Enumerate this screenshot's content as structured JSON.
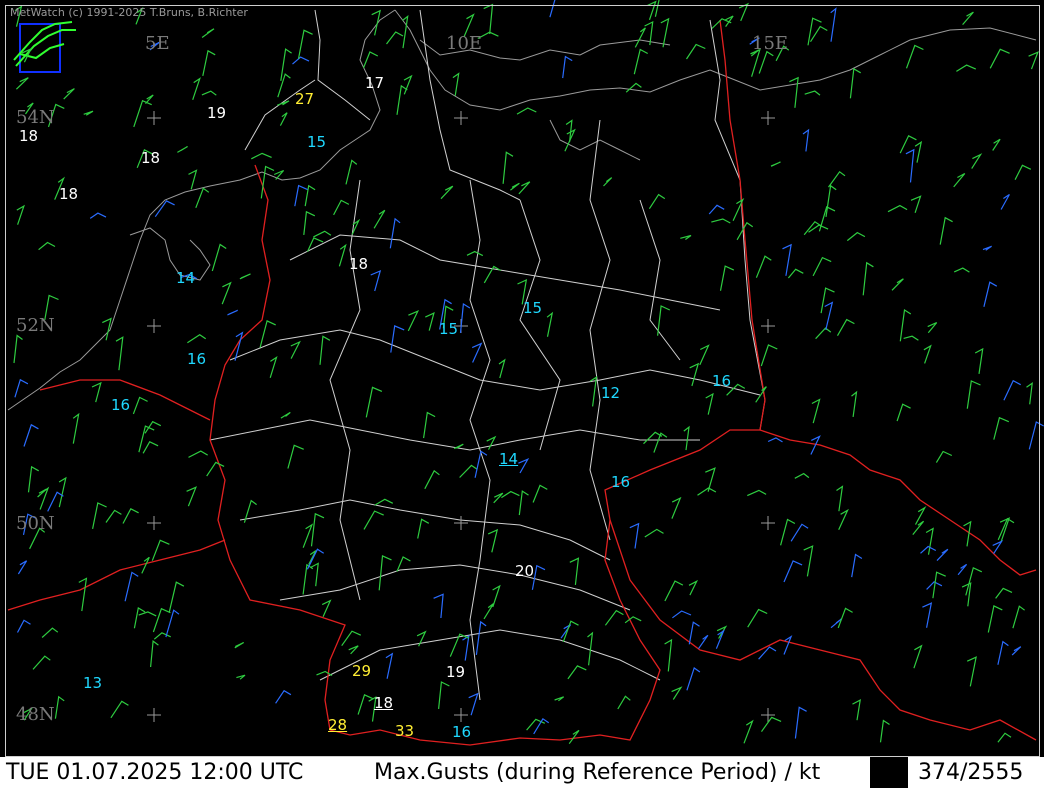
{
  "header": {
    "copyright": "MetWatch  (c) 1991-2025 T.Bruns, B.Richter"
  },
  "grid_labels": {
    "lon": [
      "5E",
      "10E",
      "15E"
    ],
    "lat": [
      "54N",
      "52N",
      "50N",
      "48N"
    ]
  },
  "station_values": [
    {
      "text": "27",
      "color": "yellow"
    },
    {
      "text": "17",
      "color": "white"
    },
    {
      "text": "19",
      "color": "white"
    },
    {
      "text": "18",
      "color": "white"
    },
    {
      "text": "18",
      "color": "white"
    },
    {
      "text": "15",
      "color": "cyan"
    },
    {
      "text": "18",
      "color": "white"
    },
    {
      "text": "14",
      "color": "cyan"
    },
    {
      "text": "18",
      "color": "white"
    },
    {
      "text": "15",
      "color": "cyan"
    },
    {
      "text": "15",
      "color": "cyan"
    },
    {
      "text": "16",
      "color": "cyan"
    },
    {
      "text": "16",
      "color": "cyan"
    },
    {
      "text": "12",
      "color": "cyan"
    },
    {
      "text": "16",
      "color": "cyan"
    },
    {
      "text": "14",
      "color": "cyan",
      "underline": true
    },
    {
      "text": "16",
      "color": "cyan"
    },
    {
      "text": "20",
      "color": "white"
    },
    {
      "text": "29",
      "color": "yellow"
    },
    {
      "text": "19",
      "color": "white"
    },
    {
      "text": "18",
      "color": "white",
      "underline": true
    },
    {
      "text": "13",
      "color": "cyan"
    },
    {
      "text": "28",
      "color": "yellow",
      "underline": true
    },
    {
      "text": "33",
      "color": "yellow"
    },
    {
      "text": "16",
      "color": "cyan"
    }
  ],
  "status": {
    "datetime": "TUE 01.07.2025 12:00 UTC",
    "product": "Max.Gusts (during Reference Period) / kt",
    "counter": "374/2555"
  }
}
